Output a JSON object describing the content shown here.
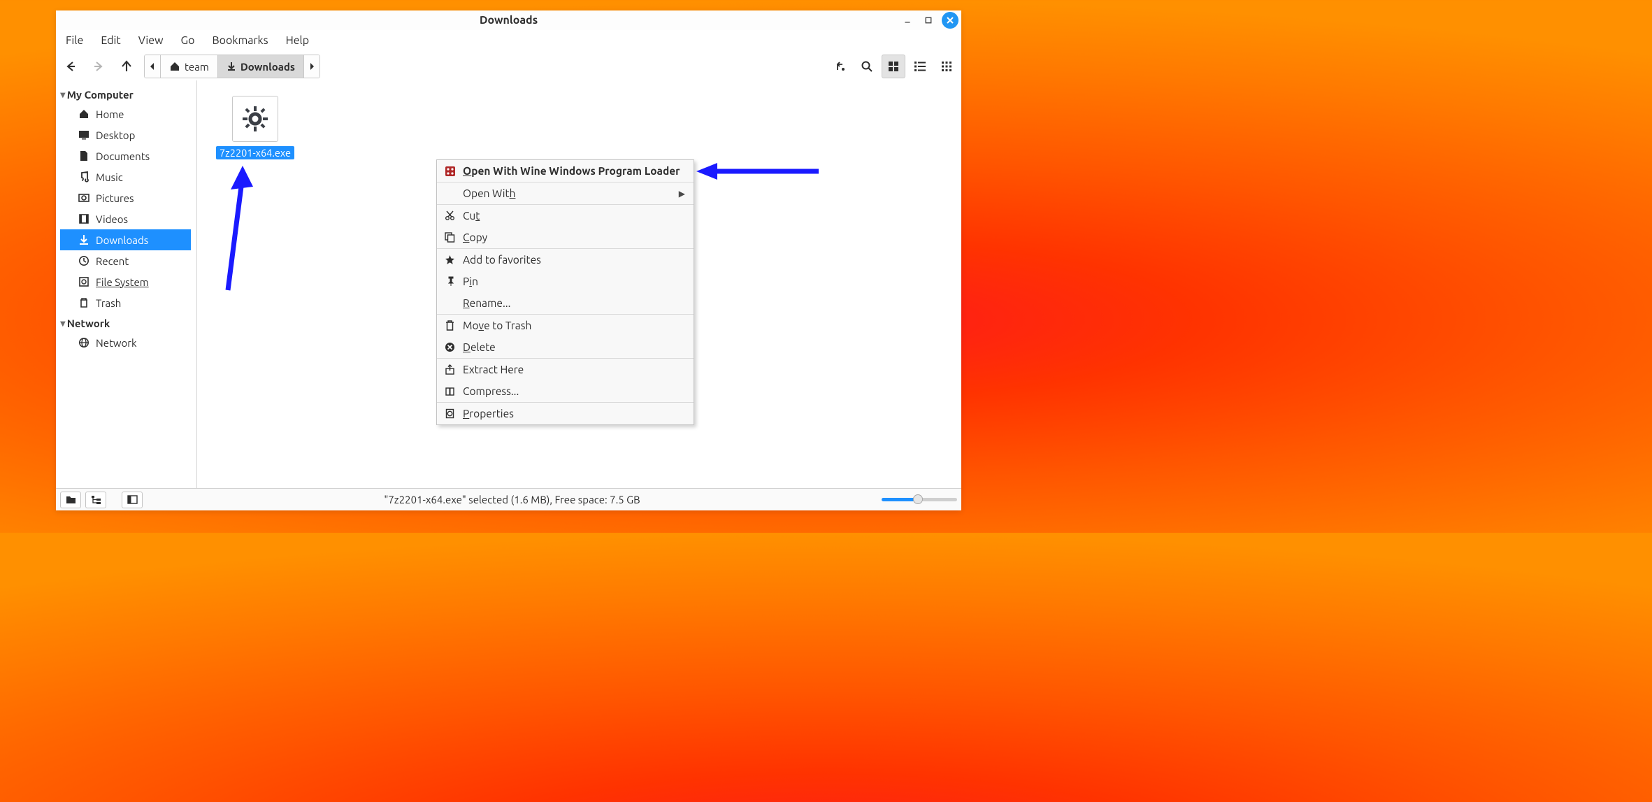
{
  "titlebar": {
    "title": "Downloads"
  },
  "menubar": [
    "File",
    "Edit",
    "View",
    "Go",
    "Bookmarks",
    "Help"
  ],
  "breadcrumb": {
    "home_label": "team",
    "current_label": "Downloads"
  },
  "sidebar": {
    "sections": [
      {
        "header": "My Computer",
        "items": [
          {
            "icon": "home",
            "label": "Home"
          },
          {
            "icon": "desktop",
            "label": "Desktop"
          },
          {
            "icon": "documents",
            "label": "Documents"
          },
          {
            "icon": "music",
            "label": "Music"
          },
          {
            "icon": "pictures",
            "label": "Pictures"
          },
          {
            "icon": "videos",
            "label": "Videos"
          },
          {
            "icon": "downloads",
            "label": "Downloads",
            "active": true
          },
          {
            "icon": "recent",
            "label": "Recent"
          },
          {
            "icon": "filesystem",
            "label": "File System",
            "underline": true
          },
          {
            "icon": "trash",
            "label": "Trash"
          }
        ]
      },
      {
        "header": "Network",
        "items": [
          {
            "icon": "network",
            "label": "Network"
          }
        ]
      }
    ]
  },
  "file": {
    "name": "7z2201-x64.exe"
  },
  "context_menu": [
    {
      "icon": "wine",
      "label": "Open With Wine Windows Program Loader",
      "bold": true,
      "mnemonic": "O"
    },
    {
      "divider": true
    },
    {
      "icon": "",
      "label": "Open With",
      "submenu": true,
      "mnemonic": "h"
    },
    {
      "divider": true
    },
    {
      "icon": "cut",
      "label": "Cut",
      "mnemonic": "t"
    },
    {
      "icon": "copy",
      "label": "Copy",
      "mnemonic": "C"
    },
    {
      "divider": true
    },
    {
      "icon": "star",
      "label": "Add to favorites"
    },
    {
      "icon": "pin",
      "label": "Pin",
      "mnemonic": "i"
    },
    {
      "icon": "",
      "label": "Rename...",
      "mnemonic": "R"
    },
    {
      "divider": true
    },
    {
      "icon": "trash",
      "label": "Move to Trash",
      "mnemonic": "v"
    },
    {
      "icon": "delete",
      "label": "Delete",
      "mnemonic": "D"
    },
    {
      "divider": true
    },
    {
      "icon": "extract",
      "label": "Extract Here"
    },
    {
      "icon": "compress",
      "label": "Compress..."
    },
    {
      "divider": true
    },
    {
      "icon": "properties",
      "label": "Properties",
      "mnemonic": "P"
    }
  ],
  "statusbar": {
    "text": "\"7z2201-x64.exe\" selected (1.6 MB), Free space: 7.5 GB",
    "zoom_percent": 48
  }
}
